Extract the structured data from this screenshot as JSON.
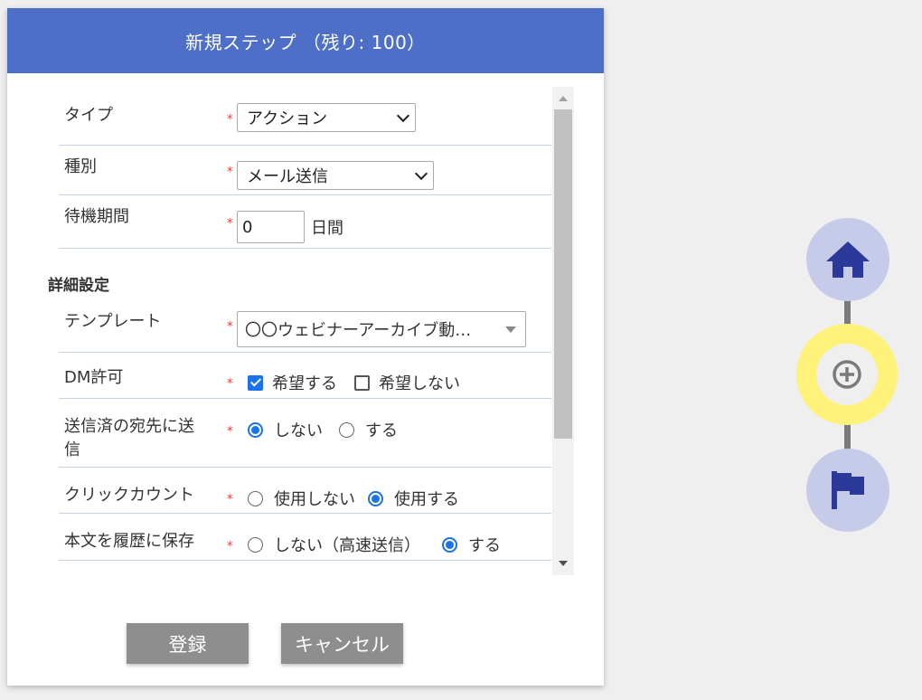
{
  "dialog": {
    "title": "新規ステップ （残り: 100）",
    "fields": {
      "type": {
        "label": "タイプ",
        "value": "アクション"
      },
      "kind": {
        "label": "種別",
        "value": "メール送信"
      },
      "wait": {
        "label": "待機期間",
        "value": "0",
        "unit": "日間"
      }
    },
    "section_title": "詳細設定",
    "template": {
      "label": "テンプレート",
      "value": "〇〇ウェビナーアーカイブ動…"
    },
    "dm": {
      "label": "DM許可",
      "options": [
        "希望する",
        "希望しない"
      ],
      "selected": "希望する"
    },
    "resend": {
      "label_line1": "送信済の宛先に送",
      "label_line2": "信",
      "options": [
        "しない",
        "する"
      ],
      "selected": "しない"
    },
    "click_count": {
      "label": "クリックカウント",
      "options": [
        "使用しない",
        "使用する"
      ],
      "selected": "使用する"
    },
    "save_body": {
      "label": "本文を履歴に保存",
      "options": [
        "しない（高速送信）",
        "する"
      ],
      "selected": "する"
    },
    "required_mark": "*",
    "submit_label": "登録",
    "cancel_label": "キャンセル"
  },
  "flow_nav": {
    "nodes": [
      {
        "icon": "home-icon"
      },
      {
        "icon": "plus-circle-icon",
        "highlighted": true
      },
      {
        "icon": "flag-icon"
      }
    ]
  },
  "colors": {
    "header_bg": "#4e6fc7",
    "accent": "#1a73e8",
    "required": "#e53935",
    "node_bg": "#c5cbe8",
    "node_highlight": "#fff27a",
    "icon_color": "#2b3a9a",
    "button_bg": "#8e8e8e"
  }
}
